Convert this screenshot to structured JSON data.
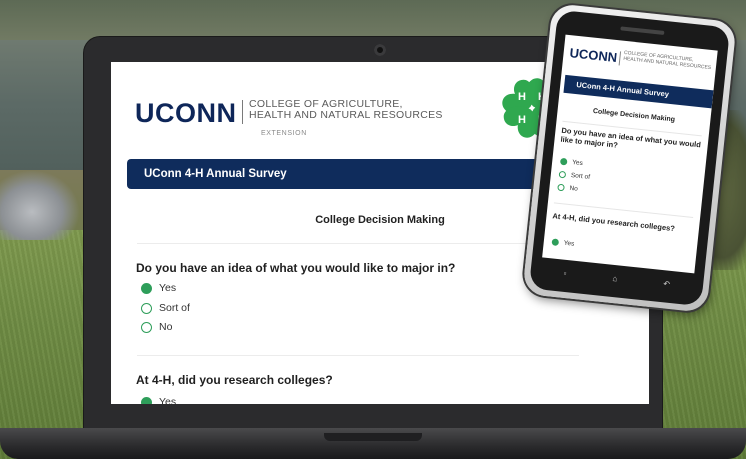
{
  "survey": {
    "logo_text": "UCONN",
    "college_line1": "COLLEGE OF AGRICULTURE,",
    "college_line2": "HEALTH AND NATURAL RESOURCES",
    "extension_label": "EXTENSION",
    "title": "UConn 4-H Annual Survey",
    "section_title": "College Decision Making",
    "questions": [
      {
        "text": "Do you have an idea of what you would like to major in?",
        "options": [
          {
            "label": "Yes",
            "selected": true
          },
          {
            "label": "Sort of",
            "selected": false
          },
          {
            "label": "No",
            "selected": false
          }
        ]
      },
      {
        "text": "At 4-H, did you research colleges?",
        "options": [
          {
            "label": "Yes",
            "selected": true
          }
        ]
      }
    ]
  },
  "colors": {
    "brand_navy": "#0f2c5c",
    "radio_green": "#2e9e5a",
    "clover_green": "#2fa84f"
  },
  "icons": {
    "clover": "4-h-clover-icon",
    "camera": "camera-icon"
  }
}
